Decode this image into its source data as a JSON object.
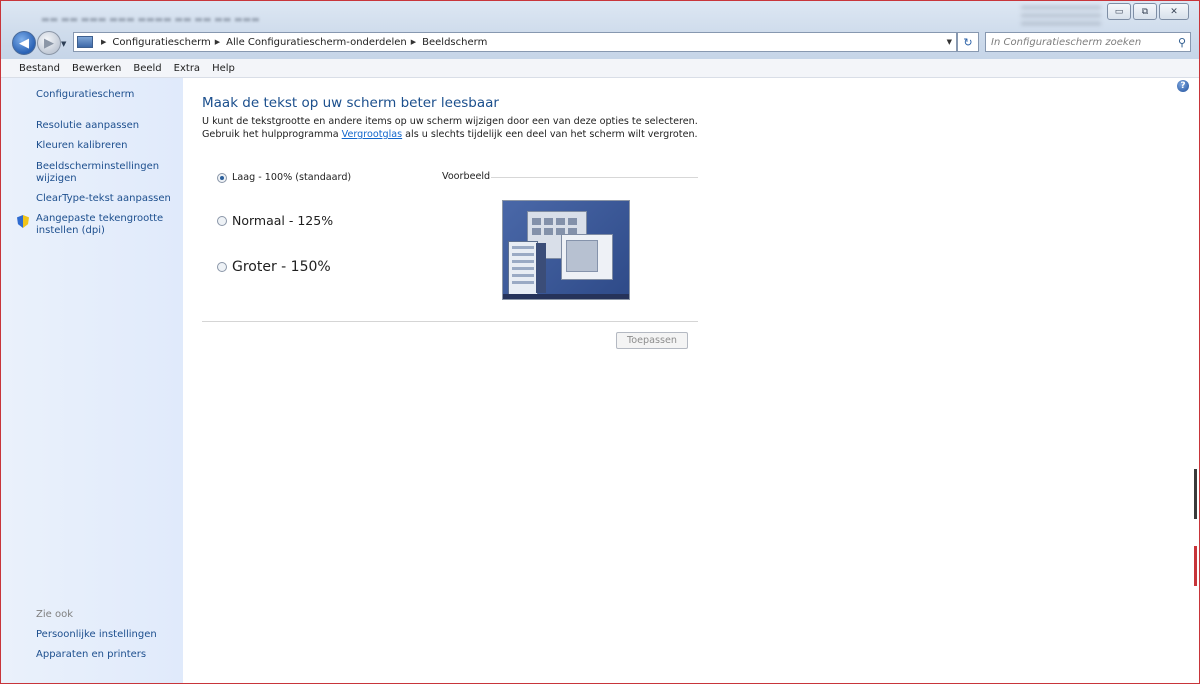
{
  "window": {
    "controls": {
      "minimize": "▭",
      "restore": "⧉",
      "close": "✕"
    }
  },
  "address_bar": {
    "crumbs": [
      "Configuratiescherm",
      "Alle Configuratiescherm-onderdelen",
      "Beeldscherm"
    ]
  },
  "search": {
    "placeholder": "In Configuratiescherm zoeken"
  },
  "menu": [
    "Bestand",
    "Bewerken",
    "Beeld",
    "Extra",
    "Help"
  ],
  "sidebar": {
    "home": "Configuratiescherm",
    "items": [
      "Resolutie aanpassen",
      "Kleuren kalibreren",
      "Beeldscherminstellingen wijzigen",
      "ClearType-tekst aanpassen",
      "Aangepaste tekengrootte instellen (dpi)"
    ],
    "see_also_title": "Zie ook",
    "see_also": [
      "Persoonlijke instellingen",
      "Apparaten en printers"
    ]
  },
  "main": {
    "title": "Maak de tekst op uw scherm beter leesbaar",
    "description_before": "U kunt de tekstgrootte en andere items op uw scherm wijzigen door een van deze opties te selecteren. Gebruik het hulpprogramma ",
    "description_link": "Vergrootglas",
    "description_after": " als u slechts tijdelijk een deel van het scherm wilt vergroten.",
    "options": [
      {
        "label": "Laag - 100% (standaard)",
        "selected": true
      },
      {
        "label": "Normaal - 125%",
        "selected": false
      },
      {
        "label": "Groter - 150%",
        "selected": false
      }
    ],
    "preview_label": "Voorbeeld",
    "apply_button": "Toepassen",
    "help_icon": "?"
  }
}
